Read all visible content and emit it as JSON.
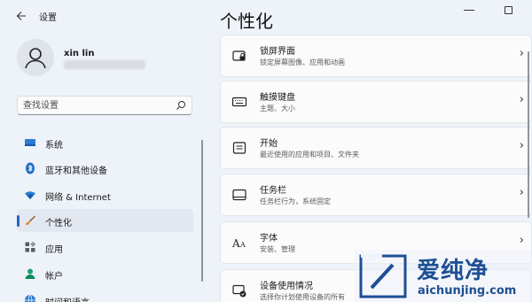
{
  "window": {
    "title": "设置",
    "back_icon": "back-arrow-icon"
  },
  "profile": {
    "name": "xin lin"
  },
  "search": {
    "placeholder": "查找设置"
  },
  "sidebar": {
    "items": [
      {
        "label": "系统",
        "icon": "monitor-icon",
        "color": "#2b7cd3"
      },
      {
        "label": "蓝牙和其他设备",
        "icon": "bluetooth-icon",
        "color": "#1f6fc5"
      },
      {
        "label": "网络 & Internet",
        "icon": "wifi-icon",
        "color": "#2b7cd3"
      },
      {
        "label": "个性化",
        "icon": "brush-icon",
        "color": "#e58a1f",
        "selected": true
      },
      {
        "label": "应用",
        "icon": "apps-icon",
        "color": "#555b66"
      },
      {
        "label": "帐户",
        "icon": "person-icon",
        "color": "#18a070"
      },
      {
        "label": "时间和语言",
        "icon": "globe-clock-icon",
        "color": "#2b7cd3"
      }
    ]
  },
  "main": {
    "title": "个性化",
    "cards": [
      {
        "title": "锁屏界面",
        "subtitle": "锁定屏幕图像、应用和动画",
        "icon": "lock-screen-icon"
      },
      {
        "title": "触摸键盘",
        "subtitle": "主题、大小",
        "icon": "keyboard-icon"
      },
      {
        "title": "开始",
        "subtitle": "最近使用的应用和项目、文件夹",
        "icon": "start-icon"
      },
      {
        "title": "任务栏",
        "subtitle": "任务栏行为，系统固定",
        "icon": "taskbar-icon"
      },
      {
        "title": "字体",
        "subtitle": "安装、管理",
        "icon": "fonts-icon"
      },
      {
        "title": "设备使用情况",
        "subtitle": "选择你计划使用设备的所有",
        "icon": "device-usage-icon"
      }
    ]
  },
  "watermark": {
    "brand": "爱纯净",
    "url": "aichunjing.com"
  },
  "colors": {
    "accent": "#2463c7",
    "background": "#eef2f9",
    "card": "#fbfbfc"
  }
}
